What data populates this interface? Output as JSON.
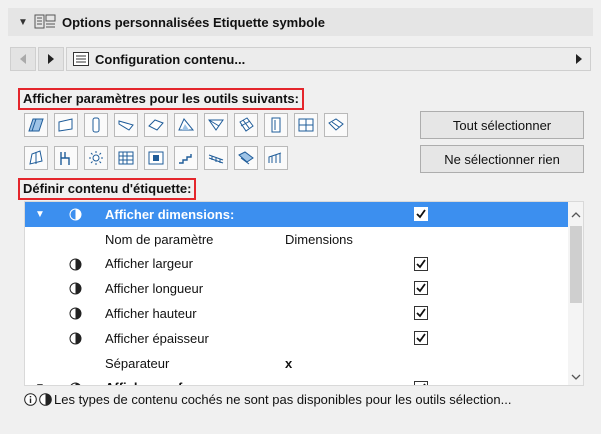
{
  "header": {
    "title": "Options personnalisées Etiquette symbole"
  },
  "page_nav": {
    "page_label": "Configuration contenu..."
  },
  "tools_section": {
    "title": "Afficher paramètres pour les outils suivants:",
    "select_all": "Tout sélectionner",
    "select_none": "Ne sélectionner rien",
    "row1_icons": [
      "wall-tool-icon",
      "slab-tool-icon",
      "column-tool-icon",
      "beam-tool-icon",
      "roof-tool-icon",
      "shell-tool-icon",
      "morph-tool-icon",
      "mesh-tool-icon",
      "door-tool-icon",
      "window-tool-icon",
      "skylight-tool-icon"
    ],
    "row2_icons": [
      "zone-tool-icon",
      "object-tool-icon",
      "lamp-tool-icon",
      "curtain-wall-tool-icon",
      "panel-tool-icon",
      "stair-tool-icon",
      "railing-tool-icon",
      "beam-segment-tool-icon",
      "wall-end-tool-icon"
    ]
  },
  "content_section": {
    "title": "Définir contenu d'étiquette:",
    "rows": [
      {
        "label": "Afficher dimensions:",
        "value": "",
        "checked": true,
        "expander": "▼",
        "mode": true,
        "selected": true,
        "bold": true
      },
      {
        "label": "Nom de paramètre",
        "value": "Dimensions",
        "checked": null,
        "expander": "",
        "mode": false,
        "selected": false,
        "bold": false
      },
      {
        "label": "Afficher largeur",
        "value": "",
        "checked": true,
        "expander": "",
        "mode": true,
        "selected": false,
        "bold": false
      },
      {
        "label": "Afficher longueur",
        "value": "",
        "checked": true,
        "expander": "",
        "mode": true,
        "selected": false,
        "bold": false
      },
      {
        "label": "Afficher hauteur",
        "value": "",
        "checked": true,
        "expander": "",
        "mode": true,
        "selected": false,
        "bold": false
      },
      {
        "label": "Afficher épaisseur",
        "value": "",
        "checked": true,
        "expander": "",
        "mode": true,
        "selected": false,
        "bold": false
      },
      {
        "label": "Séparateur",
        "value": "x",
        "checked": null,
        "expander": "",
        "mode": false,
        "selected": false,
        "bold": false
      },
      {
        "label": "Afficher surface",
        "value": "",
        "checked": true,
        "expander": "▼",
        "mode": true,
        "selected": false,
        "bold": true
      }
    ]
  },
  "footer": {
    "text": "Les types de contenu cochés ne sont pas disponibles pour les outils sélection..."
  }
}
